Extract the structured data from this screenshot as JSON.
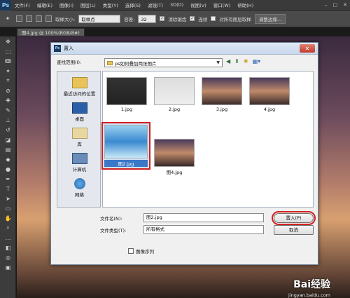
{
  "app": {
    "logo": "Ps"
  },
  "menu": [
    "文件(F)",
    "编辑(E)",
    "图像(I)",
    "图层(L)",
    "类型(Y)",
    "选择(S)",
    "滤镜(T)",
    "3D(D)",
    "视图(V)",
    "窗口(W)",
    "帮助(H)"
  ],
  "options": {
    "sample_size_label": "取样大小:",
    "sample_size_value": "取样点",
    "tolerance_label": "容差:",
    "tolerance_value": "32",
    "antialias_label": "消除锯齿",
    "contiguous_label": "连续",
    "all_layers_label": "对所有图层取样",
    "refine_edge_label": "调整边缘..."
  },
  "document_tab": "图4.jpg @ 100%(RGB/8#)",
  "dialog": {
    "title": "置入",
    "look_in_label": "查找范围(I):",
    "look_in_value": "ps如何叠加两张图片",
    "places": [
      {
        "label": "最近访问的位置"
      },
      {
        "label": "桌面"
      },
      {
        "label": "库"
      },
      {
        "label": "计算机"
      },
      {
        "label": "网络"
      }
    ],
    "files": [
      {
        "name": "1.jpg"
      },
      {
        "name": "2.jpg"
      },
      {
        "name": "3.jpg"
      },
      {
        "name": "4.jpg"
      },
      {
        "name": "图2.jpg"
      },
      {
        "name": "图4.jpg"
      }
    ],
    "filename_label": "文件名(N):",
    "filename_value": "图2.jpg",
    "filetype_label": "文件类型(T):",
    "filetype_value": "所有格式",
    "place_button": "置入(P)",
    "cancel_button": "取消",
    "sequence_label": "图像序列"
  },
  "watermark": {
    "brand": "Bai经验",
    "url": "jingyan.baidu.com"
  }
}
